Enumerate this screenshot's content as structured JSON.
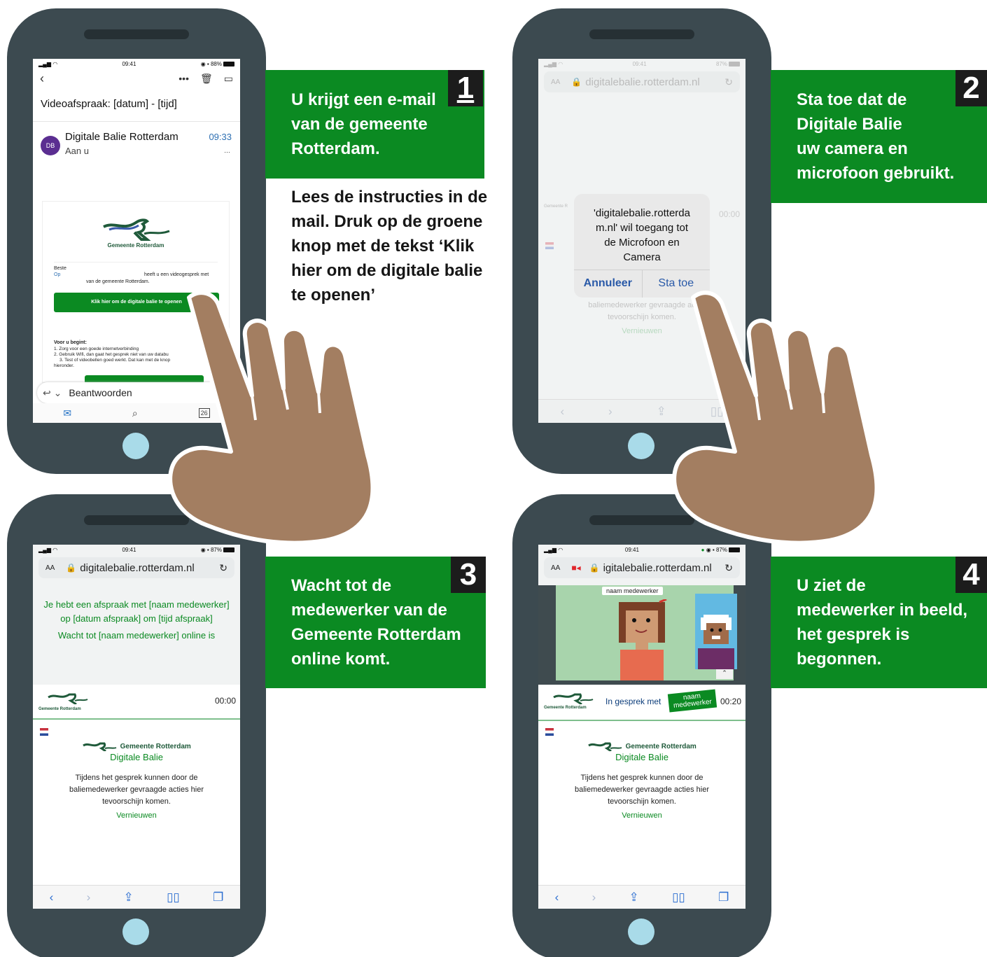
{
  "colors": {
    "green": "#0b8a22",
    "phone": "#3c4a50",
    "home_button": "#a9dbe9",
    "hand": "#a37e61"
  },
  "step1": {
    "number": "1",
    "panel_lines": [
      "U krijgt een e-mail",
      "van de gemeente",
      "Rotterdam."
    ],
    "text_lines": [
      "Lees de instructies in de",
      "mail. Druk op de groene",
      "knop met de tekst ‘Klik",
      "hier om de digitale balie",
      "te openen’"
    ],
    "phone": {
      "time": "09:41",
      "battery": "88%",
      "subject": "Videoafspraak:  [datum] - [tijd]",
      "avatar": "DB",
      "sender": "Digitale Balie Rotterdam",
      "sent_time": "09:33",
      "to": "Aan u",
      "logo_text": "Gemeente Rotterdam",
      "greeting": "Beste",
      "op": "Op",
      "body_1": "heeft u een videogesprek met",
      "body_2": "van de gemeente Rotterdam.",
      "button": "Klik hier om de digitale balie te openen",
      "before_title": "Voor u begint:",
      "before_1": "1. Zorg voor een goede internetverbinding",
      "before_2": "2. Gebruik Wifi, dan gaat het gesprek niet van uw databu",
      "before_3": "3.  Test of videobellen goed werkt. Dat kan met de knop",
      "before_4": "hieronder.",
      "reply": "Beantwoorden",
      "calendar_day": "26"
    }
  },
  "step2": {
    "number": "2",
    "panel_lines": [
      "Sta toe dat de",
      "Digitale Balie",
      "uw camera en",
      "microfoon gebruikt."
    ],
    "phone": {
      "time": "09:41",
      "battery": "87%",
      "url": "digitalebalie.rotterdam.nl",
      "aa": "AA",
      "dialog_lines": [
        "'digitalebalie.rotterda",
        "m.nl' wil toegang tot",
        "de Microfoon en",
        "Camera"
      ],
      "cancel": "Annuleer",
      "allow": "Sta toe",
      "timer": "00:00",
      "behind_1": "baliemedewerker gevraagde ac",
      "behind_2": "tevoorschijn komen.",
      "behind_link": "Vernieuwen",
      "logo_small": "Gemeente R"
    }
  },
  "step3": {
    "number": "3",
    "panel_lines": [
      "Wacht tot de",
      "medewerker van de",
      "Gemeente Rotterdam",
      "online komt."
    ],
    "phone": {
      "time": "09:41",
      "battery": "87%",
      "aa": "AA",
      "url": "digitalebalie.rotterdam.nl",
      "wait_1": "Je hebt een afspraak met [naam medewerker]",
      "wait_2": "op [datum afspraak] om [tijd afspraak]",
      "wait_3": "Wacht tot [naam medewerker] online is",
      "logo_text": "Gemeente Rotterdam",
      "timer": "00:00",
      "org": "Gemeente Rotterdam",
      "app": "Digitale Balie",
      "info_1": "Tijdens het gesprek kunnen door de",
      "info_2": "baliemedewerker gevraagde acties hier",
      "info_3": "tevoorschijn komen.",
      "link": "Vernieuwen"
    }
  },
  "step4": {
    "number": "4",
    "panel_lines": [
      "U ziet de",
      "medewerker in beeld,",
      "het gesprek is",
      "begonnen."
    ],
    "phone": {
      "time": "09:41",
      "battery": "87%",
      "aa": "AA",
      "url": "igitalebalie.rotterdam.nl",
      "name_tag": "naam medewerker",
      "in_call": "In gesprek met",
      "badge_1": "naam",
      "badge_2": "medewerker",
      "timer": "00:20",
      "logo_text": "Gemeente Rotterdam",
      "org": "Gemeente Rotterdam",
      "app": "Digitale Balie",
      "info_1": "Tijdens het gesprek kunnen door de",
      "info_2": "baliemedewerker gevraagde acties hier",
      "info_3": "tevoorschijn komen.",
      "link": "Vernieuwen"
    }
  }
}
